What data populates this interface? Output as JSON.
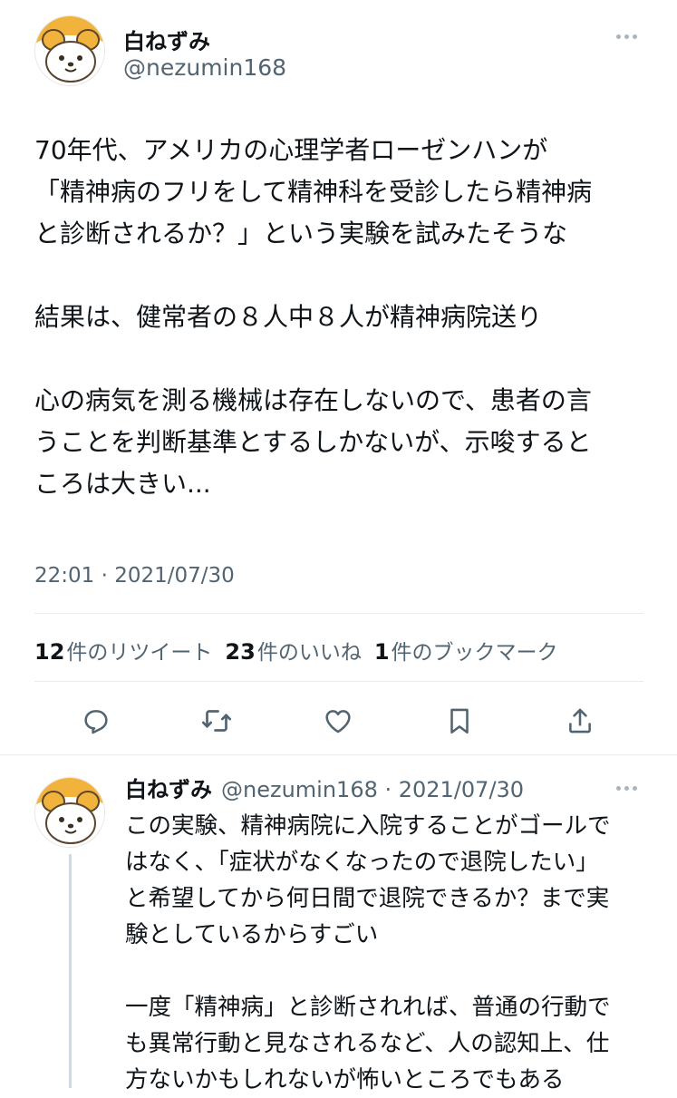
{
  "main_tweet": {
    "author_name": "白ねずみ",
    "handle": "@nezumin168",
    "lines": [
      "70年代、アメリカの心理学者ローゼンハンが",
      "「精神病のフリをして精神科を受診したら精神病",
      "と診断されるか？」という実験を試みたそうな",
      "",
      "結果は、健常者の８人中８人が精神病院送り",
      "",
      "心の病気を測る機械は存在しないので、患者の言",
      "うことを判断基準とするしかないが、示唆すると",
      "ころは大きい..."
    ],
    "timestamp": "22:01 · 2021/07/30",
    "stats": {
      "retweets_count": "12",
      "retweets_label": "件のリツイート",
      "likes_count": "23",
      "likes_label": "件のいいね",
      "bookmarks_count": "1",
      "bookmarks_label": "件のブックマーク"
    },
    "actions": [
      "reply-icon",
      "retweet-icon",
      "like-icon",
      "bookmark-icon",
      "share-icon"
    ]
  },
  "reply_tweet": {
    "author_name": "白ねずみ",
    "handle_date": "@nezumin168 · 2021/07/30",
    "lines": [
      "この実験、精神病院に入院することがゴールで",
      "はなく、「症状がなくなったので退院したい」",
      "と希望してから何日間で退院できるか？まで実",
      "験としているからすごい",
      "",
      "一度「精神病」と診断されれば、普通の行動で",
      "も異常行動と見なされるなど、人の認知上、仕",
      "方ないかもしれないが怖いところでもある"
    ]
  },
  "colors": {
    "text": "#0f1419",
    "secondary": "#536471",
    "divider": "#e6ecf0",
    "avatar_cap": "#f2b33d"
  }
}
